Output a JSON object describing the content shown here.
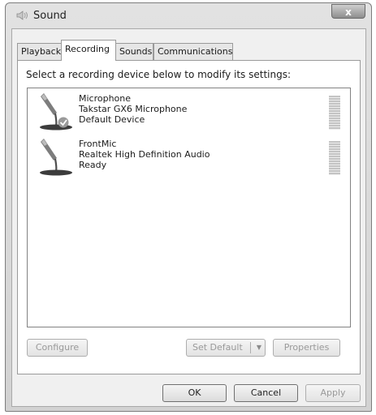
{
  "window": {
    "title": "Sound",
    "close_glyph": "x"
  },
  "tabs": [
    {
      "label": "Playback",
      "active": false
    },
    {
      "label": "Recording",
      "active": true
    },
    {
      "label": "Sounds",
      "active": false
    },
    {
      "label": "Communications",
      "active": false
    }
  ],
  "recording": {
    "instructions": "Select a recording device below to modify its settings:",
    "devices": [
      {
        "name": "Microphone",
        "description": "Takstar GX6 Microphone",
        "status": "Default Device",
        "icon": "microphone-icon",
        "is_default": true
      },
      {
        "name": "FrontMic",
        "description": "Realtek High Definition Audio",
        "status": "Ready",
        "icon": "microphone-icon",
        "is_default": false
      }
    ],
    "buttons": {
      "configure": "Configure",
      "set_default": "Set Default",
      "set_default_arrow": "▼",
      "properties": "Properties"
    }
  },
  "footer": {
    "ok": "OK",
    "cancel": "Cancel",
    "apply": "Apply"
  },
  "colors": {
    "default_check": "#3a9a2e",
    "window_frame": "#7d7d7d"
  }
}
